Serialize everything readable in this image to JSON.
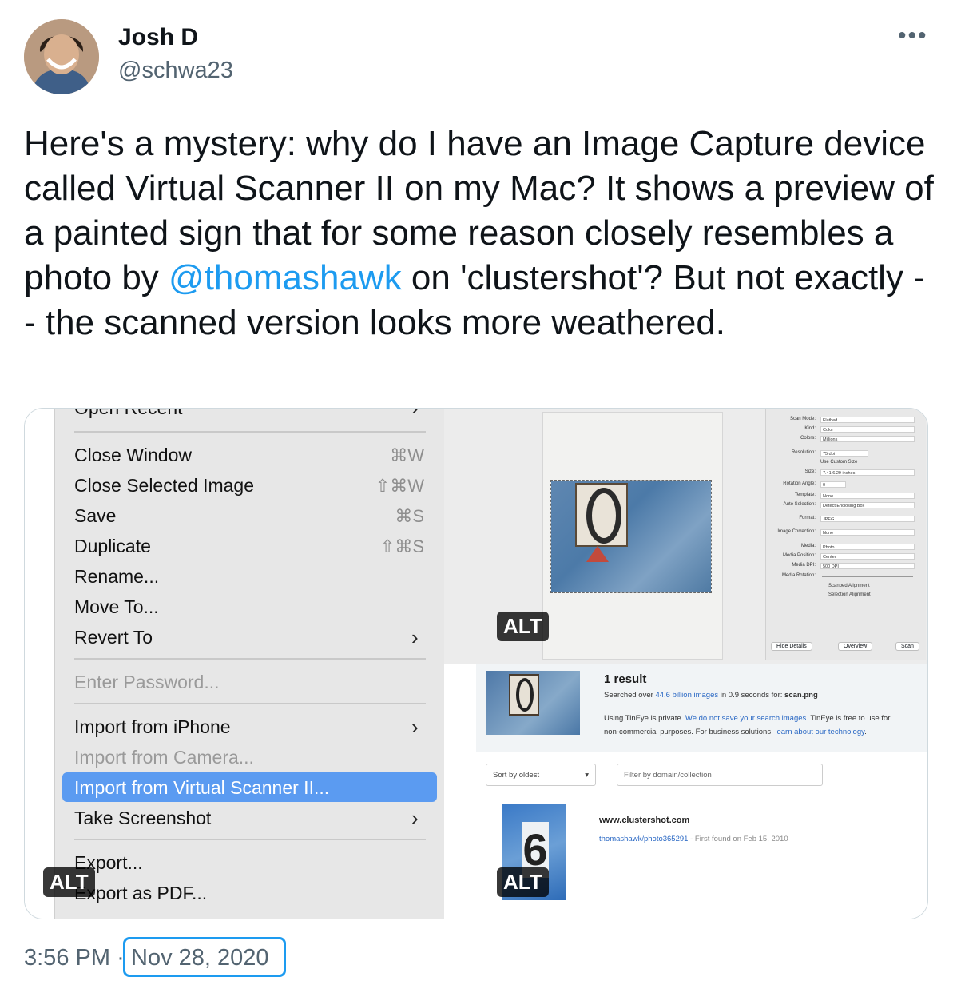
{
  "tweet": {
    "author_name": "Josh D",
    "handle": "@schwa23",
    "more_label": "•••",
    "text_before": "Here's a mystery: why do I have an Image Capture device called Virtual Scanner II on my Mac? It shows a preview of a painted sign that for some reason closely resembles a photo by ",
    "mention": "@thomashawk",
    "text_after": " on 'clustershot'? But not exactly -- the scanned version looks more weathered.",
    "time": "3:56 PM",
    "dot": "·",
    "date": "Nov 28, 2020"
  },
  "media": {
    "alt_label": "ALT",
    "menu": {
      "items": [
        {
          "label": "Open Recent",
          "shortcut": ""
        },
        {
          "label": "Close Window",
          "shortcut": "⌘W"
        },
        {
          "label": "Close Selected Image",
          "shortcut": "⇧⌘W"
        },
        {
          "label": "Save",
          "shortcut": "⌘S"
        },
        {
          "label": "Duplicate",
          "shortcut": "⇧⌘S"
        },
        {
          "label": "Rename...",
          "shortcut": ""
        },
        {
          "label": "Move To...",
          "shortcut": ""
        },
        {
          "label": "Revert To",
          "shortcut": ""
        },
        {
          "label": "Enter Password...",
          "shortcut": ""
        },
        {
          "label": "Import from iPhone",
          "shortcut": ""
        },
        {
          "label": "Import from Camera...",
          "shortcut": ""
        },
        {
          "label": "Import from Virtual Scanner II...",
          "shortcut": ""
        },
        {
          "label": "Take Screenshot",
          "shortcut": ""
        },
        {
          "label": "Export...",
          "shortcut": ""
        },
        {
          "label": "Export as PDF...",
          "shortcut": ""
        }
      ],
      "chevron": "›"
    },
    "scanner": {
      "rows": [
        {
          "label": "Scan Mode:",
          "value": "Flatbed"
        },
        {
          "label": "Kind:",
          "value": "Color"
        },
        {
          "label": "Colors:",
          "value": "Millions"
        },
        {
          "label": "Resolution:",
          "value": "75    dpi"
        },
        {
          "label": "",
          "value": "Use Custom Size"
        },
        {
          "label": "Size:",
          "value": "7.41      6.29      inches"
        },
        {
          "label": "Rotation Angle:",
          "value": "0"
        },
        {
          "label": "Template:",
          "value": "None"
        },
        {
          "label": "Auto Selection:",
          "value": "Detect Enclosing Box"
        },
        {
          "label": "Format:",
          "value": "JPEG"
        },
        {
          "label": "Image Correction:",
          "value": "None"
        },
        {
          "label": "Media:",
          "value": "Photo"
        },
        {
          "label": "Media Position:",
          "value": "Center"
        },
        {
          "label": "Media DPI:",
          "value": "500 DPI"
        },
        {
          "label": "Media Rotation:",
          "value": ""
        },
        {
          "label": "",
          "value": "Scanbed Alignment"
        },
        {
          "label": "",
          "value": "Selection Alignment"
        }
      ],
      "hide_details": "Hide Details",
      "overview": "Overview",
      "scan": "Scan"
    },
    "tineye": {
      "result_title": "1 result",
      "searched_prefix": "Searched over ",
      "searched_count": "44.6 billion images",
      "searched_suffix": " in 0.9 seconds for: ",
      "searched_file": "scan.png",
      "private_1": "Using TinEye is private. ",
      "private_link": "We do not save your search images",
      "private_2": ". TinEye is free to use for",
      "private_3": "non-commercial purposes. For business solutions, ",
      "private_link2": "learn about our technology",
      "private_4": ".",
      "sort_label": "Sort by oldest",
      "filter_placeholder": "Filter by domain/collection",
      "match_domain": "www.clustershot.com",
      "match_link": "thomashawk/photo365291",
      "match_found": " - First found on Feb 15, 2010"
    }
  },
  "colors": {
    "accent": "#1d9bf0",
    "menu_highlight": "#5b9bf1",
    "muted": "#536471"
  }
}
